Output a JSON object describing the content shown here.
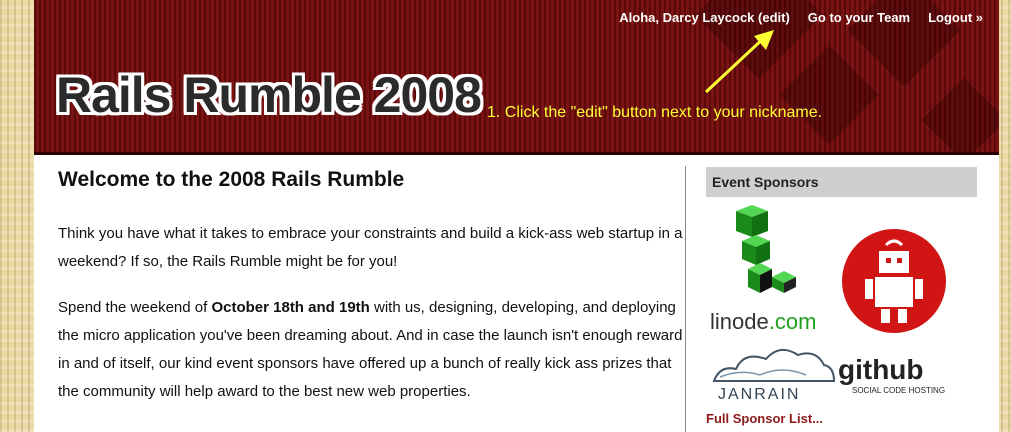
{
  "header": {
    "greeting": "Aloha, Darcy Laycock (edit)",
    "team_link": "Go to your Team",
    "logout_link": "Logout »",
    "logo": "Rails Rumble 2008",
    "callout": "1. Click the \"edit\" button next to your nickname."
  },
  "main": {
    "title": "Welcome to the 2008 Rails Rumble",
    "para1": "Think you have what it takes to embrace your constraints and build a kick-ass web startup in a weekend? If so, the Rails Rumble might be for you!",
    "para2_pre": "Spend the weekend of ",
    "para2_bold": "October 18th and 19th",
    "para2_post": " with us, designing, developing, and deploying the micro application you've been dreaming about. And in case the launch isn't enough reward in and of itself, our kind event sponsors have offered up a bunch of really kick ass prizes that the community will help award to the best new web properties."
  },
  "sidebar": {
    "heading": "Event Sponsors",
    "sponsors": [
      {
        "name": "linode.com",
        "icon": "linode-logo-icon"
      },
      {
        "name": "robot",
        "icon": "robot-logo-icon"
      },
      {
        "name": "JANRAIN",
        "icon": "janrain-logo-icon"
      },
      {
        "name": "github",
        "tagline": "SOCIAL CODE HOSTING",
        "icon": "github-logo-icon"
      }
    ],
    "full_list": "Full Sponsor List..."
  },
  "colors": {
    "header_bg": "#6b0c0c",
    "callout": "#ffff33",
    "link": "#8c1a1a",
    "linode_green": "#1fa01f",
    "robot_red": "#d11515"
  }
}
